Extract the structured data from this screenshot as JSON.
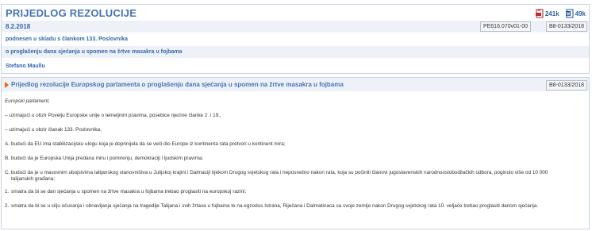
{
  "header": {
    "title": "PRIJEDLOG REZOLUCIJE",
    "pdf_size": "241k",
    "doc_size": "49k",
    "date": "8.2.2018",
    "ref_pe": "PE616.070v01-00",
    "ref_b8": "B8-0133/2018",
    "submitted": "podnesen u skladu s člankom 133. Poslovnika",
    "subject": "o proglašenju dana sjećanja u spomen na žrtve masakra u fojbama",
    "author": "Stefano Maullu"
  },
  "motion": {
    "title": "Prijedlog rezolucije Europskog parlamenta o proglašenju dana sjećanja u spomen na žrtve masakra u fojbama",
    "ref": "B8-0133/2018",
    "intro": "Europski parlament,",
    "citations": [
      "–  uzimajući u obzir Povelju Europske unije o temeljnim pravima, posebice njezine članke 2. i 19.,",
      "–  uzimajući u obzir članak 133. Poslovnika,"
    ],
    "recitals": [
      {
        "label": "A.",
        "text": "budući da EU ima stabilizacijsku ulogu koja je doprinijela da se veći dio Europe iz kontinenta rata pretvori u kontinent mira;"
      },
      {
        "label": "B.",
        "text": "budući da je Europska Unija predana miru i pomirenju, demokraciji i ljudskim pravima;"
      },
      {
        "label": "C.",
        "text": "budući da je u masovnim ubojstvima talijanskog stanovništva u Julijskoj krajini i Dalmaciji tijekom Drugog svjetskog rata i neposredno nakon rata, koja su počinili članovi jugoslavenskih narodnooslobodilačkih odbora, poginulo više od 10 000 talijanskih građana;"
      }
    ],
    "paragraphs": [
      {
        "label": "1.",
        "text": "smatra da bi se dan sjećanja u spomen na žrtve masakra u fojbama trebao proglasiti na europskoj razini;"
      },
      {
        "label": "2.",
        "text": "smatra da bi se u cilju očuvanja i obnavljanja sjećanja na tragedije Talijana i svih žrtava u fojbama te na egzodus Istrana, Riječana i Dalmatinaca sa svoje zemlje nakon Drugog svjetskog rata 10. veljače trebao proglasiti danom sjećanja."
      }
    ]
  }
}
